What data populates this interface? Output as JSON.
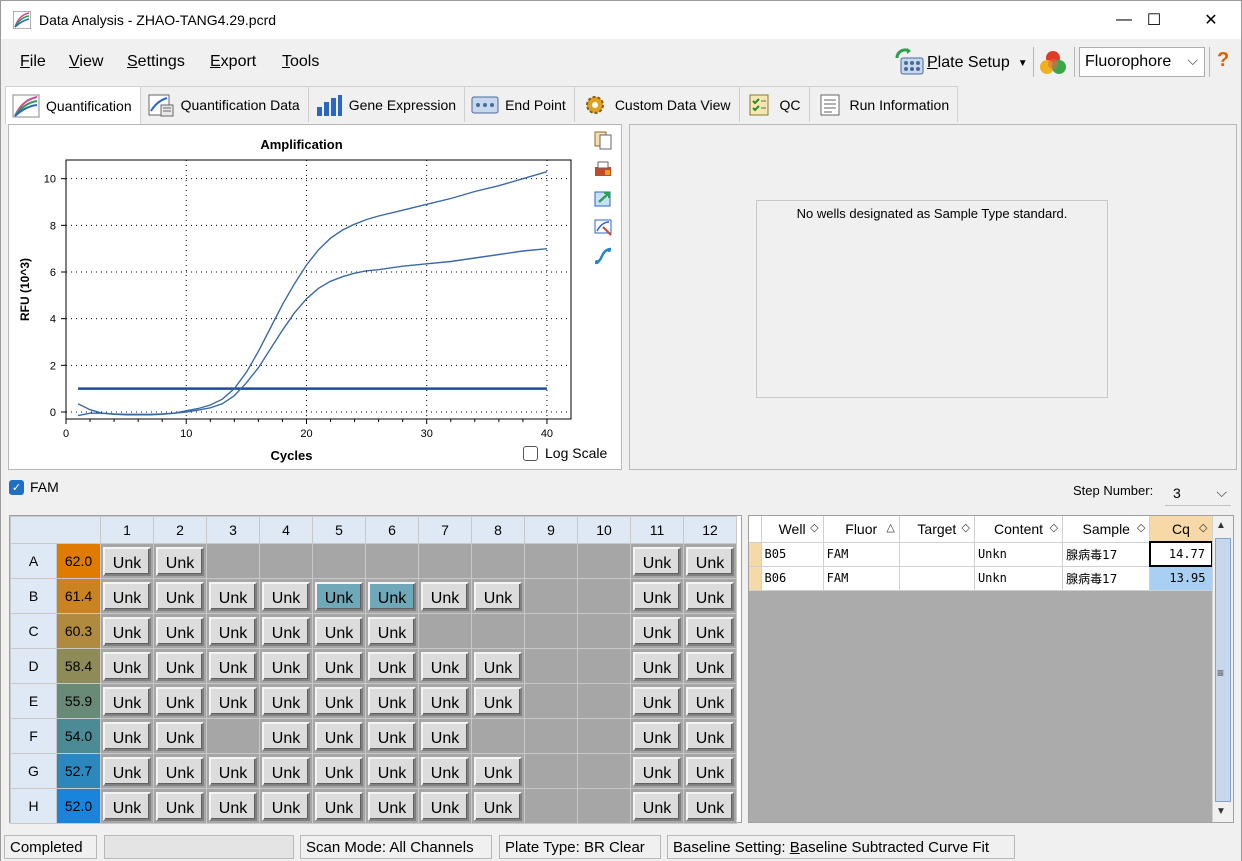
{
  "window": {
    "title": "Data Analysis - ZHAO-TANG4.29.pcrd",
    "minimize": "—",
    "maximize": "☐",
    "close": "✕"
  },
  "menu": {
    "file": "ile",
    "file_key": "F",
    "view": "iew",
    "view_key": "V",
    "settings": "ettings",
    "settings_key": "S",
    "export": "xport",
    "export_key": "E",
    "tools": "ools",
    "tools_key": "T",
    "plate_setup": "late Setup",
    "plate_setup_key": "P",
    "fluorophore": "Fluorophore",
    "help": "?"
  },
  "tabs": [
    {
      "label": "Quantification",
      "icon": "amplification-curve-icon"
    },
    {
      "label": "Quantification Data",
      "icon": "data-sheet-icon"
    },
    {
      "label": "Gene Expression",
      "icon": "bar-chart-icon"
    },
    {
      "label": "End Point",
      "icon": "end-point-icon"
    },
    {
      "label": "Custom Data View",
      "icon": "gear-icon"
    },
    {
      "label": "QC",
      "icon": "checklist-icon"
    },
    {
      "label": "Run Information",
      "icon": "document-icon"
    }
  ],
  "chart_data": {
    "type": "line",
    "title": "Amplification",
    "xlabel": "Cycles",
    "ylabel": "RFU (10^3)",
    "xlim": [
      0,
      42
    ],
    "ylim": [
      -0.3,
      10.8
    ],
    "xticks": [
      0,
      10,
      20,
      30,
      40
    ],
    "yticks": [
      0,
      2,
      4,
      6,
      8,
      10
    ],
    "grid": true,
    "series": [
      {
        "x": [
          1,
          2,
          3,
          4,
          5,
          6,
          7,
          8,
          9,
          10,
          11,
          12,
          13,
          14,
          15,
          16,
          17,
          18,
          19,
          20,
          21,
          22,
          23,
          24,
          25,
          26,
          28,
          30,
          32,
          34,
          36,
          38,
          40
        ],
        "y": [
          0.35,
          0.1,
          -0.05,
          -0.1,
          -0.12,
          -0.12,
          -0.12,
          -0.1,
          -0.05,
          0.05,
          0.15,
          0.3,
          0.55,
          1.0,
          1.7,
          2.6,
          3.6,
          4.6,
          5.5,
          6.3,
          6.95,
          7.45,
          7.8,
          8.05,
          8.25,
          8.4,
          8.65,
          8.9,
          9.15,
          9.45,
          9.7,
          10.0,
          10.3
        ]
      },
      {
        "x": [
          1,
          2,
          3,
          4,
          5,
          6,
          7,
          8,
          9,
          10,
          11,
          12,
          13,
          14,
          15,
          16,
          17,
          18,
          19,
          20,
          21,
          22,
          23,
          24,
          25,
          26,
          28,
          30,
          32,
          34,
          36,
          38,
          40
        ],
        "y": [
          -0.15,
          -0.05,
          -0.05,
          -0.08,
          -0.1,
          -0.1,
          -0.1,
          -0.08,
          -0.05,
          0.0,
          0.08,
          0.18,
          0.35,
          0.7,
          1.25,
          1.9,
          2.7,
          3.5,
          4.25,
          4.85,
          5.3,
          5.6,
          5.8,
          5.95,
          6.05,
          6.1,
          6.25,
          6.35,
          6.45,
          6.6,
          6.75,
          6.9,
          7.0
        ]
      }
    ],
    "threshold": 1.0,
    "log_scale_label": "Log Scale",
    "log_scale": false
  },
  "standard_panel": {
    "message": "No wells designated as Sample Type standard."
  },
  "fluor_filter": {
    "label": "FAM",
    "checked": true
  },
  "step": {
    "label": "Step Number:",
    "value": "3"
  },
  "plate": {
    "columns": [
      "1",
      "2",
      "3",
      "4",
      "5",
      "6",
      "7",
      "8",
      "9",
      "10",
      "11",
      "12"
    ],
    "rows": [
      {
        "label": "A",
        "temp": "62.0",
        "temp_color": "#e07b00",
        "wells": [
          "Unk",
          "Unk",
          "",
          "",
          "",
          "",
          "",
          "",
          "",
          "",
          "Unk",
          "Unk"
        ]
      },
      {
        "label": "B",
        "temp": "61.4",
        "temp_color": "#c98421",
        "wells": [
          "Unk",
          "Unk",
          "Unk",
          "Unk",
          "Unk*",
          "Unk*",
          "Unk",
          "Unk",
          "",
          "",
          "Unk",
          "Unk"
        ]
      },
      {
        "label": "C",
        "temp": "60.3",
        "temp_color": "#b08a3e",
        "wells": [
          "Unk",
          "Unk",
          "Unk",
          "Unk",
          "Unk",
          "Unk",
          "",
          "",
          "",
          "",
          "Unk",
          "Unk"
        ]
      },
      {
        "label": "D",
        "temp": "58.4",
        "temp_color": "#8e8b58",
        "wells": [
          "Unk",
          "Unk",
          "Unk",
          "Unk",
          "Unk",
          "Unk",
          "Unk",
          "Unk",
          "",
          "",
          "Unk",
          "Unk"
        ]
      },
      {
        "label": "E",
        "temp": "55.9",
        "temp_color": "#6a8a78",
        "wells": [
          "Unk",
          "Unk",
          "Unk",
          "Unk",
          "Unk",
          "Unk",
          "Unk",
          "Unk",
          "",
          "",
          "Unk",
          "Unk"
        ]
      },
      {
        "label": "F",
        "temp": "54.0",
        "temp_color": "#4c8a96",
        "wells": [
          "Unk",
          "Unk",
          "",
          "Unk",
          "Unk",
          "Unk",
          "Unk",
          "",
          "",
          "",
          "Unk",
          "Unk"
        ]
      },
      {
        "label": "G",
        "temp": "52.7",
        "temp_color": "#2c87bd",
        "wells": [
          "Unk",
          "Unk",
          "Unk",
          "Unk",
          "Unk",
          "Unk",
          "Unk",
          "Unk",
          "",
          "",
          "Unk",
          "Unk"
        ]
      },
      {
        "label": "H",
        "temp": "52.0",
        "temp_color": "#1a84dc",
        "wells": [
          "Unk",
          "Unk",
          "Unk",
          "Unk",
          "Unk",
          "Unk",
          "Unk",
          "Unk",
          "",
          "",
          "Unk",
          "Unk"
        ]
      }
    ]
  },
  "results": {
    "headers": [
      "Well",
      "Fluor",
      "Target",
      "Content",
      "Sample",
      "Cq"
    ],
    "rows": [
      {
        "well": "B05",
        "fluor": "FAM",
        "target": "",
        "content": "Unkn",
        "sample": "腺病毒17",
        "cq": "14.77"
      },
      {
        "well": "B06",
        "fluor": "FAM",
        "target": "",
        "content": "Unkn",
        "sample": "腺病毒17",
        "cq": "13.95"
      }
    ]
  },
  "status": {
    "state": "Completed",
    "progress": "",
    "scan_mode": "Scan Mode: All Channels",
    "plate_type": "Plate Type: BR Clear",
    "baseline_prefix": "Baseline Setting: ",
    "baseline_key": "B",
    "baseline_rest": "aseline Subtracted Curve Fit"
  }
}
